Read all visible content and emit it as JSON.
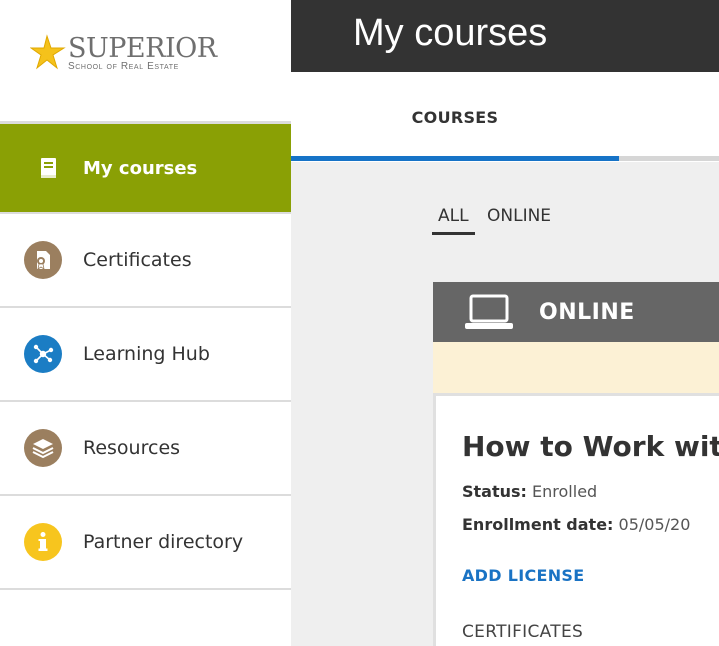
{
  "brand": {
    "name": "SUPERIOR",
    "tagline": "School of Real Estate"
  },
  "sidebar": {
    "items": [
      {
        "label": "My courses",
        "icon": "book-icon",
        "active": true
      },
      {
        "label": "Certificates",
        "icon": "certificate-icon",
        "active": false
      },
      {
        "label": "Learning Hub",
        "icon": "network-hub-icon",
        "active": false
      },
      {
        "label": "Resources",
        "icon": "layers-icon",
        "active": false
      },
      {
        "label": "Partner directory",
        "icon": "info-icon",
        "active": false
      }
    ]
  },
  "header": {
    "title": "My courses"
  },
  "tabs": {
    "courses_label": "COURSES"
  },
  "filters": {
    "all_label": "ALL",
    "online_label": "ONLINE"
  },
  "card": {
    "type_label": "ONLINE",
    "title": "How to Work with",
    "status_label": "Status:",
    "status_value": "Enrolled",
    "enrollment_label": "Enrollment date:",
    "enrollment_value": "05/05/20",
    "add_license_label": "ADD LICENSE",
    "certificates_label": "CERTIFICATES"
  },
  "colors": {
    "active_nav": "#8aa005",
    "header_bg": "#333333",
    "tab_accent": "#1673c7",
    "link": "#1a73c4",
    "icon_tan": "#9b7f5f",
    "icon_blue": "#1b7dc4",
    "icon_yellow": "#f7c51e"
  }
}
